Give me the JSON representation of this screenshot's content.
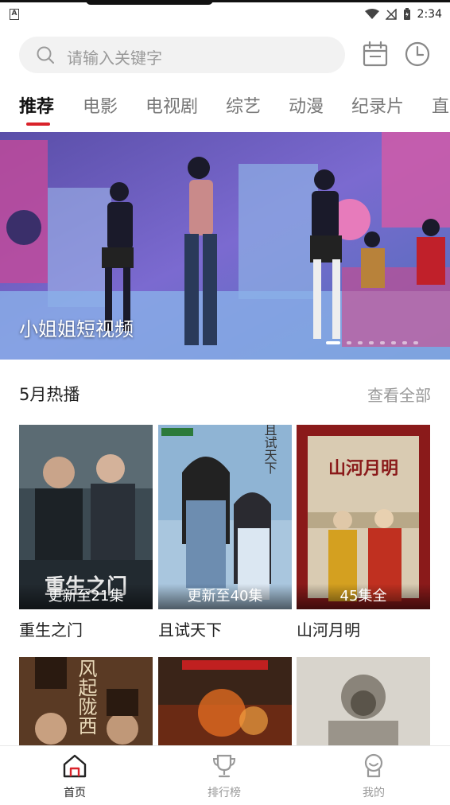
{
  "status_bar": {
    "app_indicator": "A",
    "time": "2:34"
  },
  "search": {
    "placeholder": "请输入关键字"
  },
  "tabs": [
    {
      "label": "推荐",
      "active": true
    },
    {
      "label": "电影",
      "active": false
    },
    {
      "label": "电视剧",
      "active": false
    },
    {
      "label": "综艺",
      "active": false
    },
    {
      "label": "动漫",
      "active": false
    },
    {
      "label": "纪录片",
      "active": false
    },
    {
      "label": "直",
      "active": false
    }
  ],
  "banner": {
    "title": "小姐姐短视频",
    "slide_count": 8,
    "active_slide": 1
  },
  "section": {
    "title": "5月热播",
    "more_label": "查看全部"
  },
  "cards": [
    {
      "name": "重生之门",
      "badge": "更新至21集",
      "poster_overlay": "重生之门"
    },
    {
      "name": "且试天下",
      "badge": "更新至40集",
      "poster_overlay": "且试天下"
    },
    {
      "name": "山河月明",
      "badge": "45集全",
      "poster_overlay": "山河月明"
    }
  ],
  "cards_row2": [
    {
      "poster_overlay": "风起陇西"
    },
    {
      "poster_overlay": ""
    },
    {
      "poster_overlay": ""
    }
  ],
  "bottom_nav": [
    {
      "label": "首页",
      "icon": "home-icon",
      "active": true
    },
    {
      "label": "排行榜",
      "icon": "trophy-icon",
      "active": false
    },
    {
      "label": "我的",
      "icon": "profile-icon",
      "active": false
    }
  ],
  "colors": {
    "accent": "#d9222a",
    "muted": "#999999"
  }
}
